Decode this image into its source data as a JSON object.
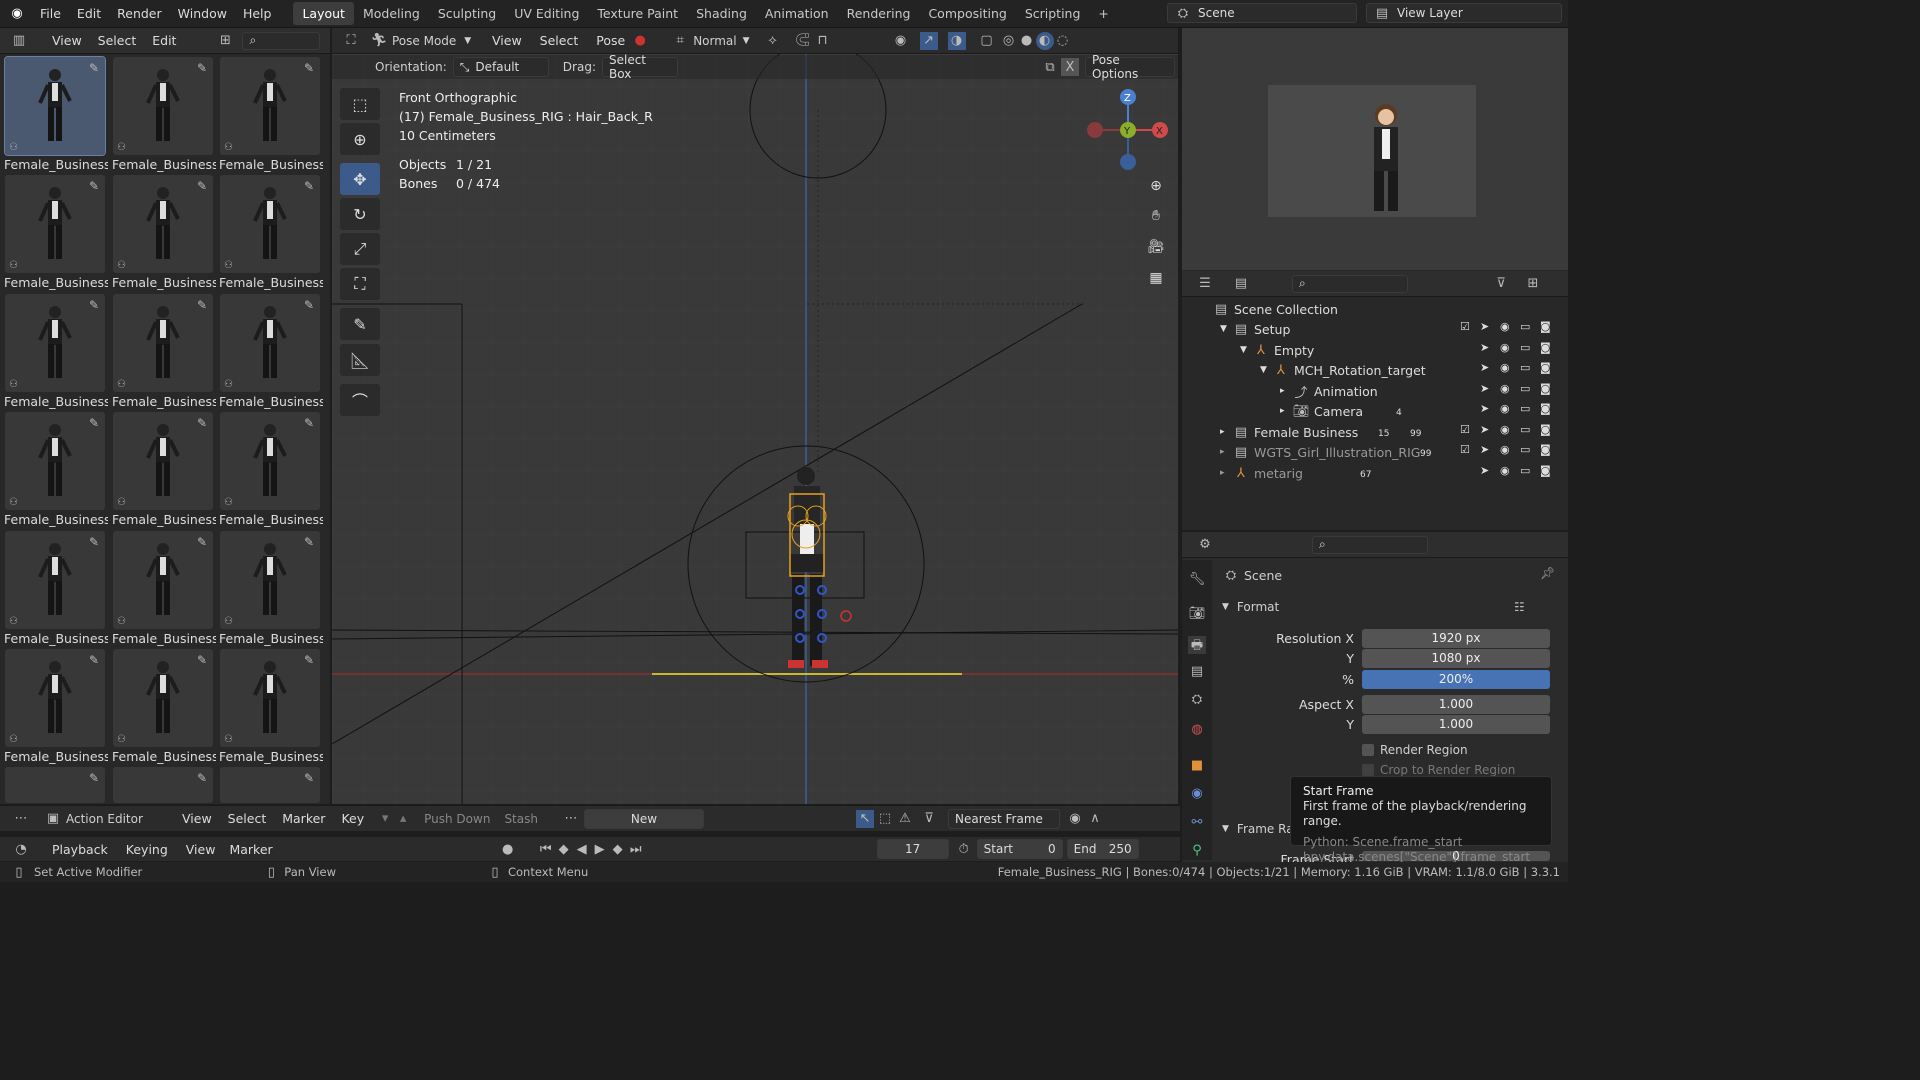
{
  "topbar": {
    "menus": [
      "File",
      "Edit",
      "Render",
      "Window",
      "Help"
    ],
    "workspaces": [
      "Layout",
      "Modeling",
      "Sculpting",
      "UV Editing",
      "Texture Paint",
      "Shading",
      "Animation",
      "Rendering",
      "Compositing",
      "Scripting"
    ],
    "active_workspace": "Layout",
    "scene": "Scene",
    "view_layer": "View Layer"
  },
  "asset_browser": {
    "menus": [
      "View",
      "Select",
      "Edit"
    ],
    "items": [
      {
        "label": "Female_Business_...",
        "selected": true
      },
      {
        "label": "Female_Business_..."
      },
      {
        "label": "Female_Business_..."
      },
      {
        "label": "Female_Business_..."
      },
      {
        "label": "Female_Business_..."
      },
      {
        "label": "Female_Business_..."
      },
      {
        "label": "Female_Business_..."
      },
      {
        "label": "Female_Business_..."
      },
      {
        "label": "Female_Business_..."
      },
      {
        "label": "Female_Business_..."
      },
      {
        "label": "Female_Business_..."
      },
      {
        "label": "Female_Business_..."
      },
      {
        "label": "Female_Business_..."
      },
      {
        "label": "Female_Business_..."
      },
      {
        "label": "Female_Business_..."
      },
      {
        "label": "Female_Business_..."
      },
      {
        "label": "Female_Business_..."
      },
      {
        "label": "Female_Business_..."
      }
    ]
  },
  "viewport": {
    "mode": "Pose Mode",
    "menus": [
      "View",
      "Select",
      "Pose"
    ],
    "transform": "Normal",
    "orientation_label": "Orientation:",
    "orientation": "Default",
    "drag_label": "Drag:",
    "drag": "Select Box",
    "pose_options": "Pose Options",
    "x_label": "X",
    "overlay": {
      "view": "Front Orthographic",
      "object": "(17) Female_Business_RIG : Hair_Back_R",
      "scale": "10 Centimeters",
      "objects_label": "Objects",
      "objects_value": "1 / 21",
      "bones_label": "Bones",
      "bones_value": "0 / 474"
    },
    "gizmo": {
      "z": "Z",
      "y": "Y",
      "x": "X"
    }
  },
  "outliner": {
    "items": [
      {
        "label": "Scene Collection",
        "depth": 0
      },
      {
        "label": "Setup",
        "depth": 1
      },
      {
        "label": "Empty",
        "depth": 2
      },
      {
        "label": "MCH_Rotation_target",
        "depth": 3
      },
      {
        "label": "Animation",
        "depth": 4
      },
      {
        "label": "Camera",
        "depth": 4
      },
      {
        "label": "Female Business",
        "depth": 1
      },
      {
        "label": "WGTS_Girl_Illustration_RIG",
        "depth": 1
      },
      {
        "label": "metarig",
        "depth": 1
      }
    ],
    "badges": {
      "camera": "4",
      "female": "15",
      "female2": "99",
      "wgts": "99",
      "metarig": "67"
    }
  },
  "properties": {
    "context": "Scene",
    "panel": "Format",
    "res_x_label": "Resolution X",
    "res_x": "1920 px",
    "res_y_label": "Y",
    "res_y": "1080 px",
    "pct_label": "%",
    "pct": "200%",
    "aspect_x_label": "Aspect X",
    "aspect_x": "1.000",
    "aspect_y_label": "Y",
    "aspect_y": "1.000",
    "render_region": "Render Region",
    "crop": "Crop to Render Region",
    "frame_range": "Frame Ra",
    "frame_start": "Frame Start",
    "frame_start_val": "0"
  },
  "tooltip": {
    "title": "Start Frame",
    "desc": "First frame of the playback/rendering range.",
    "python1": "Python: Scene.frame_start",
    "python2": "bpy.data.scenes[\"Scene\"].frame_start"
  },
  "action_editor": {
    "mode": "Action Editor",
    "menus": [
      "View",
      "Select",
      "Marker",
      "Key"
    ],
    "push_down": "Push Down",
    "stash": "Stash",
    "new": "New",
    "snap": "Nearest Frame"
  },
  "timeline": {
    "menus": [
      "Playback",
      "Keying",
      "View",
      "Marker"
    ],
    "current_frame": "17",
    "start_label": "Start",
    "start": "0",
    "end_label": "End",
    "end": "250"
  },
  "statusbar": {
    "left1": "Set Active Modifier",
    "left2": "Pan View",
    "left3": "Context Menu",
    "right": "Female_Business_RIG | Bones:0/474 | Objects:1/21 | Memory: 1.16 GiB | VRAM: 1.1/8.0 GiB | 3.3.1"
  }
}
